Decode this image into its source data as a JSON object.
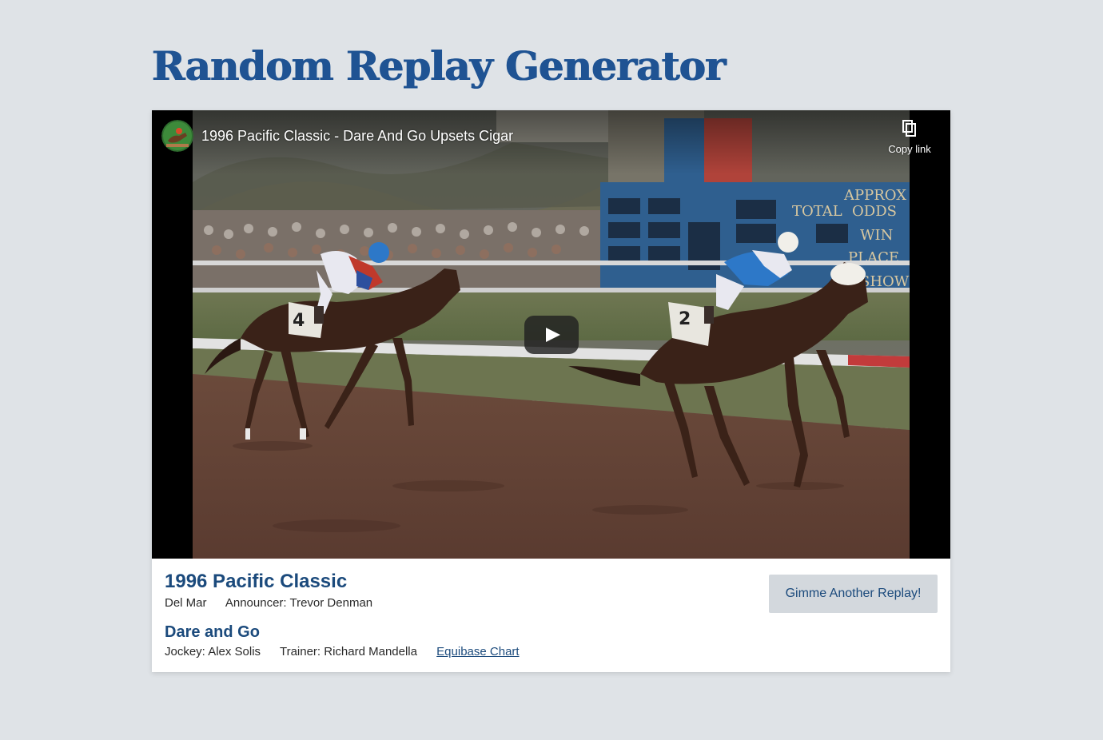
{
  "page": {
    "title": "Random Replay Generator"
  },
  "video": {
    "title": "1996 Pacific Classic - Dare And Go Upsets Cigar",
    "copy_link_label": "Copy link",
    "icons": {
      "channel": "channel-avatar-icon",
      "copy": "copy-icon",
      "play": "play-icon"
    }
  },
  "race": {
    "name": "1996 Pacific Classic",
    "track": "Del Mar",
    "announcer": "Announcer: Trevor Denman",
    "winner": "Dare and Go",
    "jockey": "Jockey: Alex Solis",
    "trainer": "Trainer: Richard Mandella",
    "chart_link": "Equibase Chart"
  },
  "actions": {
    "replay_label": "Gimme Another Replay!"
  },
  "colors": {
    "background": "#dfe3e7",
    "title": "#1f5393",
    "heading": "#1b4a7c",
    "button_bg": "#d3d8dd"
  }
}
